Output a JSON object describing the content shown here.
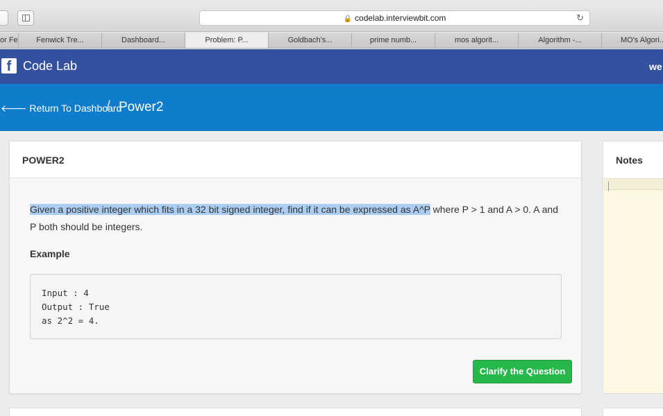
{
  "browser": {
    "url": "codelab.interviewbit.com",
    "tabs": [
      {
        "label": "or Fe"
      },
      {
        "label": "Fenwick Tre..."
      },
      {
        "label": "Dashboard..."
      },
      {
        "label": "Problem: P..."
      },
      {
        "label": "Goldbach's..."
      },
      {
        "label": "prime numb..."
      },
      {
        "label": "mos algorit..."
      },
      {
        "label": "Algorithm -..."
      },
      {
        "label": "MO's Algori..."
      }
    ],
    "active_tab_index": 3
  },
  "header": {
    "logo_letter": "f",
    "brand": "Code Lab",
    "welcome": "we"
  },
  "breadcrumb": {
    "back_label": "🡐 Return To Dashboard",
    "separator": "/",
    "current": "Power2"
  },
  "problem": {
    "title": "POWER2",
    "text_highlighted": "Given a positive integer which fits in a 32 bit signed integer, find if it can be expressed as A^P",
    "text_rest": " where P > 1 and A > 0. A and P both should be integers.",
    "example_title": "Example",
    "example_code": "Input : 4\nOutput : True\nas 2^2 = 4.",
    "clarify_button": "Clarify the Question"
  },
  "notes": {
    "title": "Notes",
    "content": ""
  },
  "colors": {
    "header_bg": "#34519f",
    "breadcrumb_bg": "#0f7dcb",
    "button_green": "#27b84b",
    "selection": "#abcdf2",
    "notes_bg": "#fcf8e3"
  },
  "icons": {
    "url_lock": "lock-icon",
    "reload": "reload-icon",
    "sidebar_toggle": "sidebar-icon",
    "back_arrow": "arrow-left-icon"
  }
}
